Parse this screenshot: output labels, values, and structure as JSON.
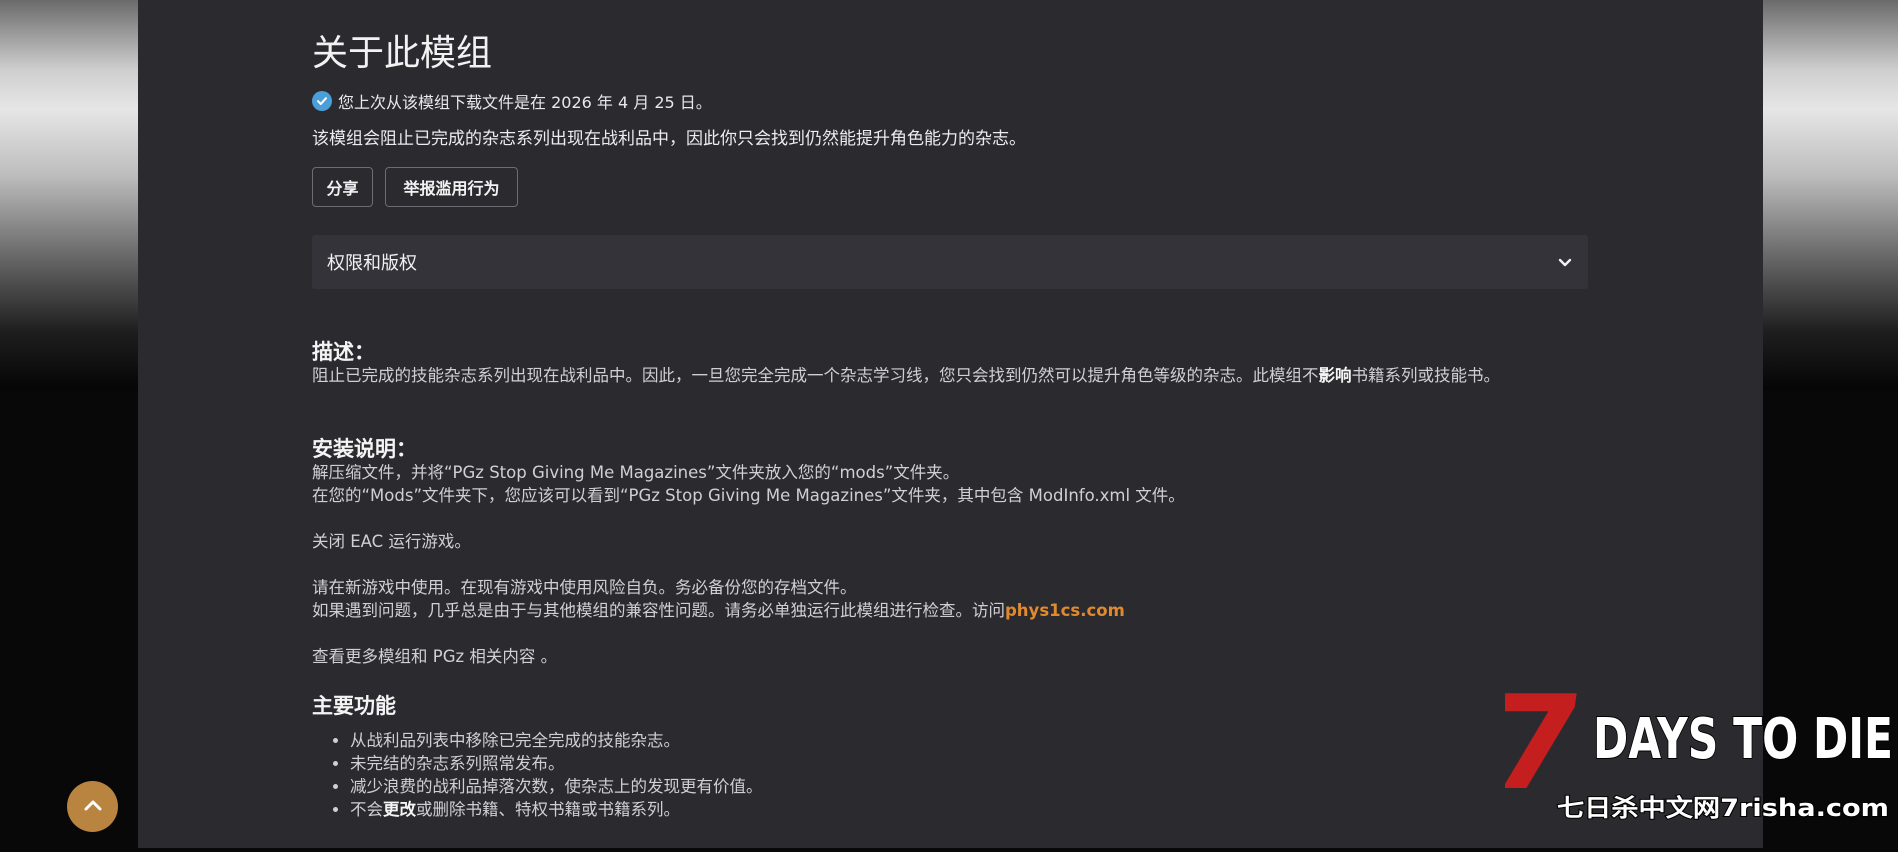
{
  "page": {
    "title": "关于此模组",
    "download_notice": "您上次从该模组下载文件是在 2026 年 4 月 25 日。",
    "summary": "该模组会阻止已完成的杂志系列出现在战利品中，因此你只会找到仍然能提升角色能力的杂志。",
    "buttons": {
      "share": "分享",
      "report": "举报滥用行为"
    },
    "accordion": {
      "label": "权限和版权"
    }
  },
  "description": {
    "heading": "描述：",
    "text_pre": "阻止已完成的技能杂志系列出现在战利品中。因此，一旦您完全完成一个杂志学习线，您只会找到仍然可以提升角色等级的杂志。此模组不",
    "text_bold": "影响",
    "text_post": "书籍系列或技能书。"
  },
  "install": {
    "heading": "安装说明：",
    "line1": "解压缩文件，并将“PGz Stop Giving Me Magazines”文件夹放入您的“mods”文件夹。",
    "line2": "在您的“Mods”文件夹下，您应该可以看到“PGz Stop Giving Me Magazines”文件夹，其中包含 ModInfo.xml 文件。",
    "line3": "关闭 EAC 运行游戏。",
    "line4": "请在新游戏中使用。在现有游戏中使用风险自负。务必备份您的存档文件。",
    "line5_pre": "如果遇到问题，几乎总是由于与其他模组的兼容性问题。请务必单独运行此模组进行检查。访问",
    "line5_link": "phys1cs.com",
    "line6": "查看更多模组和 PGz 相关内容 。"
  },
  "features": {
    "heading": "主要功能",
    "item1": "从战利品列表中移除已完全完成的技能杂志。",
    "item2": "未完结的杂志系列照常发布。",
    "item3": "减少浪费的战利品掉落次数，使杂志上的发现更有价值。",
    "item4_pre": "不会",
    "item4_bold": "更改",
    "item4_post": "或删除书籍、特权书籍或书籍系列。"
  },
  "logo": {
    "main": "DAYS TO DIE",
    "seven": "7",
    "sub": "七日杀中文网7risha.com"
  },
  "icons": {
    "check": "check-circle-icon",
    "chevron": "chevron-down-icon",
    "scroll_top": "chevron-up-icon"
  },
  "colors": {
    "accent": "#e08a2e",
    "panel": "#2b2a2f",
    "check": "#4a9fd8",
    "scroll_button": "#b98340",
    "logo_red": "#c41e1e"
  }
}
